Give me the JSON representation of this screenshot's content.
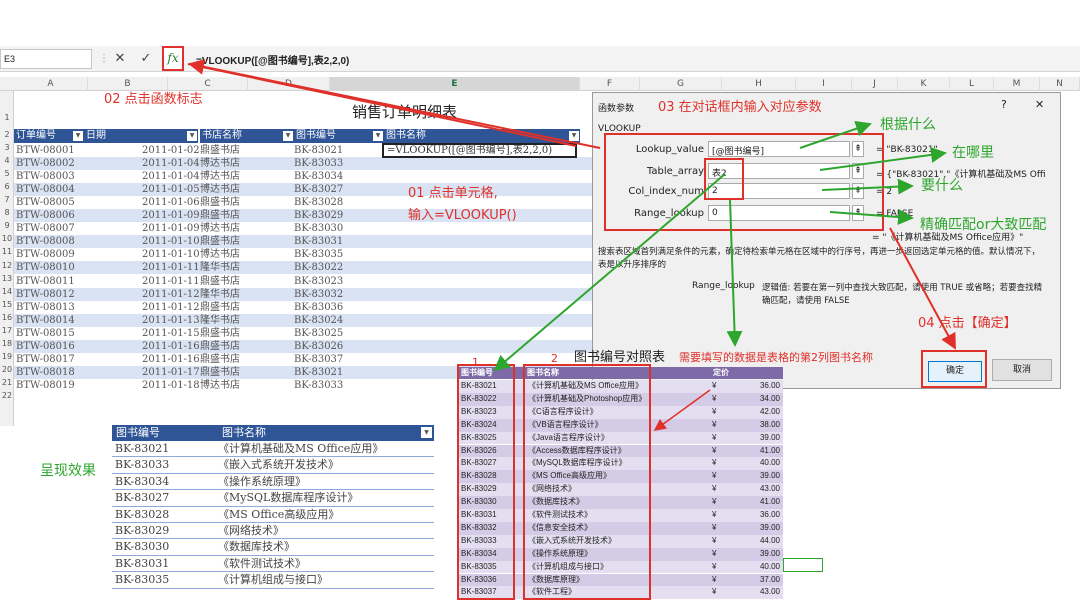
{
  "name_box": "E3",
  "fx_label": "fx",
  "formula": "=VLOOKUP([@图书编号],表2,2,0)",
  "columns": [
    "A",
    "B",
    "C",
    "D",
    "E",
    "F",
    "G",
    "H",
    "I",
    "J",
    "K",
    "L",
    "M",
    "N"
  ],
  "rows": [
    "1",
    "2",
    "3",
    "4",
    "5",
    "6",
    "7",
    "8",
    "9",
    "10",
    "11",
    "12",
    "13",
    "14",
    "15",
    "16",
    "17",
    "18",
    "19",
    "20",
    "21",
    "22"
  ],
  "sheet": {
    "title": "销售订单明细表",
    "headers": [
      "订单编号",
      "日期",
      "书店名称",
      "图书编号",
      "图书名称"
    ],
    "active_cell": "=VLOOKUP([@图书编号],表2,2,0)",
    "data": [
      [
        "BTW-08001",
        "2011-01-02",
        "鼎盛书店",
        "BK-83021"
      ],
      [
        "BTW-08002",
        "2011-01-04",
        "博达书店",
        "BK-83033"
      ],
      [
        "BTW-08003",
        "2011-01-04",
        "博达书店",
        "BK-83034"
      ],
      [
        "BTW-08004",
        "2011-01-05",
        "博达书店",
        "BK-83027"
      ],
      [
        "BTW-08005",
        "2011-01-06",
        "鼎盛书店",
        "BK-83028"
      ],
      [
        "BTW-08006",
        "2011-01-09",
        "鼎盛书店",
        "BK-83029"
      ],
      [
        "BTW-08007",
        "2011-01-09",
        "博达书店",
        "BK-83030"
      ],
      [
        "BTW-08008",
        "2011-01-10",
        "鼎盛书店",
        "BK-83031"
      ],
      [
        "BTW-08009",
        "2011-01-10",
        "博达书店",
        "BK-83035"
      ],
      [
        "BTW-08010",
        "2011-01-11",
        "隆华书店",
        "BK-83022"
      ],
      [
        "BTW-08011",
        "2011-01-11",
        "鼎盛书店",
        "BK-83023"
      ],
      [
        "BTW-08012",
        "2011-01-12",
        "隆华书店",
        "BK-83032"
      ],
      [
        "BTW-08013",
        "2011-01-12",
        "鼎盛书店",
        "BK-83036"
      ],
      [
        "BTW-08014",
        "2011-01-13",
        "隆华书店",
        "BK-83024"
      ],
      [
        "BTW-08015",
        "2011-01-15",
        "鼎盛书店",
        "BK-83025"
      ],
      [
        "BTW-08016",
        "2011-01-16",
        "鼎盛书店",
        "BK-83026"
      ],
      [
        "BTW-08017",
        "2011-01-16",
        "鼎盛书店",
        "BK-83037"
      ],
      [
        "BTW-08018",
        "2011-01-17",
        "鼎盛书店",
        "BK-83021"
      ],
      [
        "BTW-08019",
        "2011-01-18",
        "博达书店",
        "BK-83033"
      ]
    ]
  },
  "annotations": {
    "a02": "02 点击函数标志",
    "a01_line1": "01 点击单元格,",
    "a01_line2": "输入=VLOOKUP()",
    "a03": "03 在对话框内输入对应参数",
    "a04": "04 点击【确定】",
    "g1": "根据什么",
    "g2": "在哪里",
    "g3": "要什么",
    "g4": "精确匹配or大致匹配",
    "note_col2": "需要填写的数据是表格的第2列图书名称",
    "n1": "1",
    "n2": "2",
    "result_label": "呈现效果"
  },
  "dialog": {
    "title": "函数参数",
    "func": "VLOOKUP",
    "help_close": "?",
    "close": "✕",
    "args": [
      {
        "label": "Lookup_value",
        "value": "[@图书编号]",
        "result": "= \"BK-83021\""
      },
      {
        "label": "Table_array",
        "value": "表2",
        "result": "= {\"BK-83021\",\"《计算机基础及MS Office"
      },
      {
        "label": "Col_index_num",
        "value": "2",
        "result": "= 2"
      },
      {
        "label": "Range_lookup",
        "value": "0",
        "result": "= FALSE"
      }
    ],
    "final_result": "= \"《计算机基础及MS Office应用》\"",
    "desc": "搜索表区域首列满足条件的元素，确定待检索单元格在区域中的行序号，再进一步返回选定单元格的值。默认情况下，表是以升序排序的",
    "param_name": "Range_lookup",
    "param_desc_line1": "逻辑值: 若要在第一列中查找大致匹配，请使用 TRUE 或省略；若要查找精",
    "param_desc_line2": "确匹配，请使用 FALSE",
    "ok": "确定",
    "cancel": "取消"
  },
  "lookup": {
    "title": "图书编号对照表",
    "headers": [
      "图书编号",
      "图书名称",
      "定价"
    ],
    "currency": "¥",
    "rows": [
      [
        "BK-83021",
        "《计算机基础及MS Office应用》",
        "36.00"
      ],
      [
        "BK-83022",
        "《计算机基础及Photoshop应用》",
        "34.00"
      ],
      [
        "BK-83023",
        "《C语言程序设计》",
        "42.00"
      ],
      [
        "BK-83024",
        "《VB语言程序设计》",
        "38.00"
      ],
      [
        "BK-83025",
        "《Java语言程序设计》",
        "39.00"
      ],
      [
        "BK-83026",
        "《Access数据库程序设计》",
        "41.00"
      ],
      [
        "BK-83027",
        "《MySQL数据库程序设计》",
        "40.00"
      ],
      [
        "BK-83028",
        "《MS Office高级应用》",
        "39.00"
      ],
      [
        "BK-83029",
        "《网络技术》",
        "43.00"
      ],
      [
        "BK-83030",
        "《数据库技术》",
        "41.00"
      ],
      [
        "BK-83031",
        "《软件测试技术》",
        "36.00"
      ],
      [
        "BK-83032",
        "《信息安全技术》",
        "39.00"
      ],
      [
        "BK-83033",
        "《嵌入式系统开发技术》",
        "44.00"
      ],
      [
        "BK-83034",
        "《操作系统原理》",
        "39.00"
      ],
      [
        "BK-83035",
        "《计算机组成与接口》",
        "40.00"
      ],
      [
        "BK-83036",
        "《数据库原理》",
        "37.00"
      ],
      [
        "BK-83037",
        "《软件工程》",
        "43.00"
      ]
    ]
  },
  "result": {
    "headers": [
      "图书编号",
      "图书名称"
    ],
    "rows": [
      [
        "BK-83021",
        "《计算机基础及MS Office应用》"
      ],
      [
        "BK-83033",
        "《嵌入式系统开发技术》"
      ],
      [
        "BK-83034",
        "《操作系统原理》"
      ],
      [
        "BK-83027",
        "《MySQL数据库程序设计》"
      ],
      [
        "BK-83028",
        "《MS Office高级应用》"
      ],
      [
        "BK-83029",
        "《网络技术》"
      ],
      [
        "BK-83030",
        "《数据库技术》"
      ],
      [
        "BK-83031",
        "《软件测试技术》"
      ],
      [
        "BK-83035",
        "《计算机组成与接口》"
      ]
    ]
  },
  "colors": {
    "table_header": "#2f5597",
    "annotation_red": "#e0302a",
    "annotation_green": "#2ea62e",
    "lookup_header": "#7f6aa8"
  }
}
